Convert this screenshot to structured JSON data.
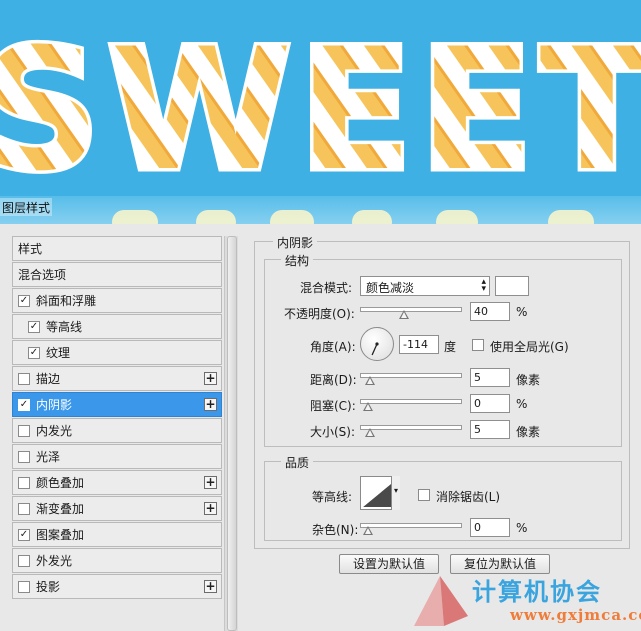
{
  "preview": {
    "text": "SWEET",
    "background_color": "#3fb0e4"
  },
  "dialog": {
    "title": "图层样式"
  },
  "style_list": [
    {
      "label": "样式",
      "checkbox": false,
      "checked": false,
      "plus": false,
      "indent": false,
      "selected": false
    },
    {
      "label": "混合选项",
      "checkbox": false,
      "checked": false,
      "plus": false,
      "indent": false,
      "selected": false
    },
    {
      "label": "斜面和浮雕",
      "checkbox": true,
      "checked": true,
      "plus": false,
      "indent": false,
      "selected": false
    },
    {
      "label": "等高线",
      "checkbox": true,
      "checked": true,
      "plus": false,
      "indent": true,
      "selected": false
    },
    {
      "label": "纹理",
      "checkbox": true,
      "checked": true,
      "plus": false,
      "indent": true,
      "selected": false
    },
    {
      "label": "描边",
      "checkbox": true,
      "checked": false,
      "plus": true,
      "indent": false,
      "selected": false
    },
    {
      "label": "内阴影",
      "checkbox": true,
      "checked": true,
      "plus": true,
      "indent": false,
      "selected": true
    },
    {
      "label": "内发光",
      "checkbox": true,
      "checked": false,
      "plus": false,
      "indent": false,
      "selected": false
    },
    {
      "label": "光泽",
      "checkbox": true,
      "checked": false,
      "plus": false,
      "indent": false,
      "selected": false
    },
    {
      "label": "颜色叠加",
      "checkbox": true,
      "checked": false,
      "plus": true,
      "indent": false,
      "selected": false
    },
    {
      "label": "渐变叠加",
      "checkbox": true,
      "checked": false,
      "plus": true,
      "indent": false,
      "selected": false
    },
    {
      "label": "图案叠加",
      "checkbox": true,
      "checked": true,
      "plus": false,
      "indent": false,
      "selected": false
    },
    {
      "label": "外发光",
      "checkbox": true,
      "checked": false,
      "plus": false,
      "indent": false,
      "selected": false
    },
    {
      "label": "投影",
      "checkbox": true,
      "checked": false,
      "plus": true,
      "indent": false,
      "selected": false
    }
  ],
  "inner_shadow": {
    "section_title": "内阴影",
    "structure": {
      "title": "结构",
      "blend_mode_label": "混合模式:",
      "blend_mode_value": "颜色减淡",
      "blend_color": "#ffffff",
      "opacity_label": "不透明度(O):",
      "opacity_value": "40",
      "opacity_level": 40,
      "percent": "%",
      "angle_label": "角度(A):",
      "angle_value": "-114",
      "angle_deg": -114,
      "degree_unit": "度",
      "global_light_label": "使用全局光(G)",
      "global_light_checked": false,
      "distance_label": "距离(D):",
      "distance_value": "5",
      "distance_level": 5,
      "pixel_unit": "像素",
      "choke_label": "阻塞(C):",
      "choke_value": "0",
      "choke_level": 0,
      "size_label": "大小(S):",
      "size_value": "5",
      "size_level": 5
    },
    "quality": {
      "title": "品质",
      "contour_label": "等高线:",
      "antialias_label": "消除锯齿(L)",
      "antialias_checked": false,
      "noise_label": "杂色(N):",
      "noise_value": "0",
      "noise_level": 0
    },
    "buttons": {
      "make_default": "设置为默认值",
      "reset_default": "复位为默认值"
    }
  },
  "watermark": {
    "title": "计算机协会",
    "url": "www.gxjmca.com"
  }
}
